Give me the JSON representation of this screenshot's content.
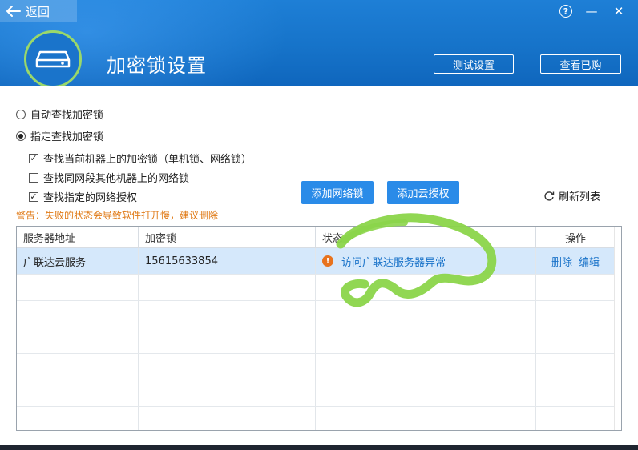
{
  "header": {
    "back_label": "返回",
    "title": "加密锁设置",
    "test_button": "测试设置",
    "bought_button": "查看已购",
    "help_glyph": "?",
    "minimize_glyph": "—",
    "close_glyph": "✕"
  },
  "options": {
    "auto_find": "自动查找加密锁",
    "specify_find": "指定查找加密锁",
    "selected_mode": "specify_find",
    "checks": [
      {
        "label": "查找当前机器上的加密锁（单机锁、网络锁）",
        "checked": true
      },
      {
        "label": "查找同网段其他机器上的网络锁",
        "checked": false
      },
      {
        "label": "查找指定的网络授权",
        "checked": true
      }
    ]
  },
  "actions": {
    "add_network_lock": "添加网络锁",
    "add_cloud_auth": "添加云授权",
    "refresh_list": "刷新列表"
  },
  "warning": "警告：失败的状态会导致软件打开慢，建议删除",
  "table": {
    "headers": [
      "服务器地址",
      "加密锁",
      "状态",
      "操作"
    ],
    "rows": [
      {
        "server": "广联达云服务",
        "lock": "15615633854",
        "status": "访问广联达服务器异常",
        "delete": "删除",
        "edit": "编辑"
      }
    ]
  },
  "colors": {
    "header_blue": "#1673c9",
    "button_blue": "#2a8be8",
    "warning_orange": "#e07b18",
    "selected_row": "#d5e8fb",
    "scribble_green": "#8bd54a"
  }
}
